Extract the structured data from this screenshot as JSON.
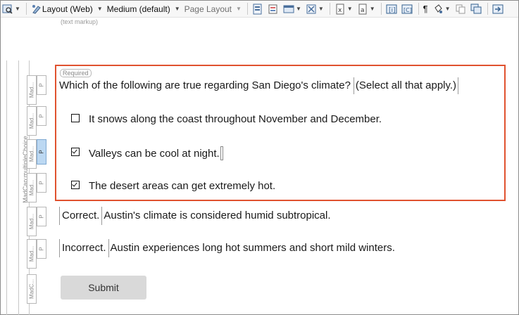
{
  "toolbar": {
    "layout_label": "Layout (Web)",
    "medium_label": "Medium (default)",
    "page_layout_label": "Page Layout",
    "paragraph_symbol": "¶"
  },
  "text_markup": "(text markup)",
  "structure": {
    "multiple_choice_label": "MadCap:multipleChoice",
    "tags": [
      "Mad...",
      "P",
      "Mad...",
      "P",
      "Mad...",
      "P",
      "Mad...",
      "P",
      "Mad...",
      "P",
      "Mad...",
      "P",
      "MadC..."
    ]
  },
  "question": {
    "required_label": "Required",
    "text": "Which of the following are true regarding San Diego's climate?",
    "hint": "(Select all that apply.)",
    "options": [
      {
        "label": "It snows along the coast throughout November and December.",
        "checked": false
      },
      {
        "label": "Valleys can be cool at night.",
        "checked": true
      },
      {
        "label": "The desert areas can get extremely hot.",
        "checked": true
      }
    ]
  },
  "feedback": {
    "correct_tag": "Correct.",
    "correct_text": "Austin's climate is considered humid subtropical.",
    "incorrect_tag": "Incorrect.",
    "incorrect_text": "Austin experiences long hot summers and short mild winters."
  },
  "submit_label": "Submit",
  "colors": {
    "question_border": "#e0522f",
    "selected_tag": "#bcd8f2",
    "submit_bg": "#d9d9d9"
  }
}
